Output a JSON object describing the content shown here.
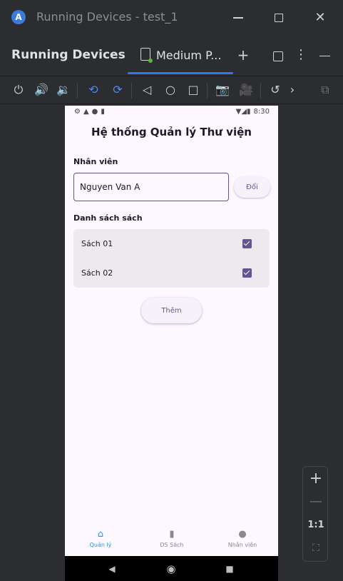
{
  "window": {
    "title": "Running Devices - test_1",
    "minimize_glyph": "",
    "close_glyph": "✕"
  },
  "tool_window": {
    "title": "Running Devices",
    "tab_label": "Medium P...",
    "add_glyph": "+",
    "more_glyph": "⋮"
  },
  "toolbar": {
    "icons": [
      "power-icon",
      "volume-up-icon",
      "volume-down-icon",
      "rotate-left-icon",
      "rotate-right-icon",
      "back-icon",
      "home-icon",
      "overview-icon",
      "screenshot-icon",
      "screen-record-icon",
      "snapshot-icon",
      "more-icon",
      "device-mirroring-icon"
    ],
    "accent_color": "#4d8cf5"
  },
  "device": {
    "status": {
      "time": "8:30"
    },
    "app": {
      "title": "Hệ thống Quản lý Thư viện",
      "employee_section": "Nhân viên",
      "employee_value": "Nguyen Van A",
      "change_button": "Đổi",
      "books_section": "Danh sách sách",
      "books": [
        {
          "name": "Sách 01",
          "checked": true
        },
        {
          "name": "Sách 02",
          "checked": true
        }
      ],
      "add_button": "Thêm"
    },
    "bottom_nav": [
      {
        "label": "Quản lý",
        "icon": "home-icon",
        "active": true
      },
      {
        "label": "DS Sách",
        "icon": "book-icon",
        "active": false
      },
      {
        "label": "Nhân viên",
        "icon": "person-icon",
        "active": false
      }
    ],
    "primary_color": "#65558f",
    "nav_active_color": "#2196f3"
  },
  "zoom": {
    "zoom_in": "+",
    "zoom_out": "—",
    "actual_size": "1:1"
  }
}
